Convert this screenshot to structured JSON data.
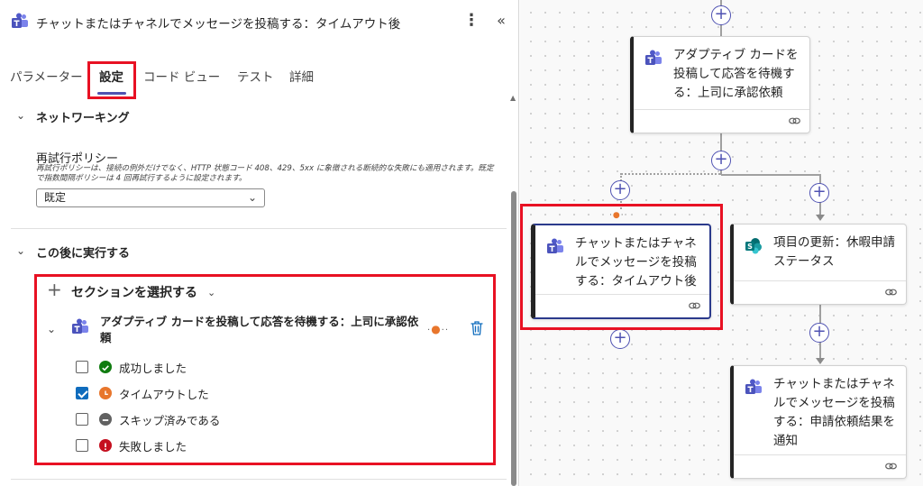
{
  "header": {
    "title": "チャットまたはチャネルでメッセージを投稿する：タイムアウト後",
    "more_glyph": "⋮",
    "collapse_glyph": "«"
  },
  "tabs": [
    {
      "label": "パラメーター"
    },
    {
      "label": "設定"
    },
    {
      "label": "コード ビュー"
    },
    {
      "label": "テスト"
    },
    {
      "label": "詳細"
    }
  ],
  "networking": {
    "section_title": "ネットワーキング",
    "retry_label": "再試行ポリシー",
    "retry_desc": "再試行ポリシーは、接続の例外だけでなく、HTTP 状態コード 408、429、5xx に象徴される断続的な失敗にも適用されます。既定で指数間隔ポリシーは 4 回再試行するように設定されます。",
    "retry_value": "既定"
  },
  "run_after": {
    "section_title": "この後に実行する",
    "select_section": "セクションを選択する",
    "action_title": "アダプティブ カードを投稿して応答を待機する：上司に承認依頼",
    "statuses": [
      {
        "label": "成功しました",
        "checked": false,
        "color": "#107c10",
        "icon": "check-circle-icon"
      },
      {
        "label": "タイムアウトした",
        "checked": true,
        "color": "#e8762c",
        "icon": "clock-icon"
      },
      {
        "label": "スキップ済みである",
        "checked": false,
        "color": "#616161",
        "icon": "minus-circle-icon"
      },
      {
        "label": "失敗しました",
        "checked": false,
        "color": "#c50f1f",
        "icon": "error-circle-icon"
      }
    ]
  },
  "canvas": {
    "cards": [
      {
        "title": "アダプティブ カードを投稿して応答を待機する：上司に承認依頼",
        "icon": "teams-icon"
      },
      {
        "title": "チャットまたはチャネルでメッセージを投稿する：タイムアウト後",
        "icon": "teams-icon"
      },
      {
        "title": "項目の更新：休暇申請ステータス",
        "icon": "sharepoint-icon"
      },
      {
        "title": "チャットまたはチャネルでメッセージを投稿する：申請依頼結果を通知",
        "icon": "teams-icon"
      }
    ],
    "add_glyph": "+"
  },
  "colors": {
    "accent": "#4f52b2",
    "highlight": "#e81123",
    "checkbox": "#0f6cbd"
  }
}
